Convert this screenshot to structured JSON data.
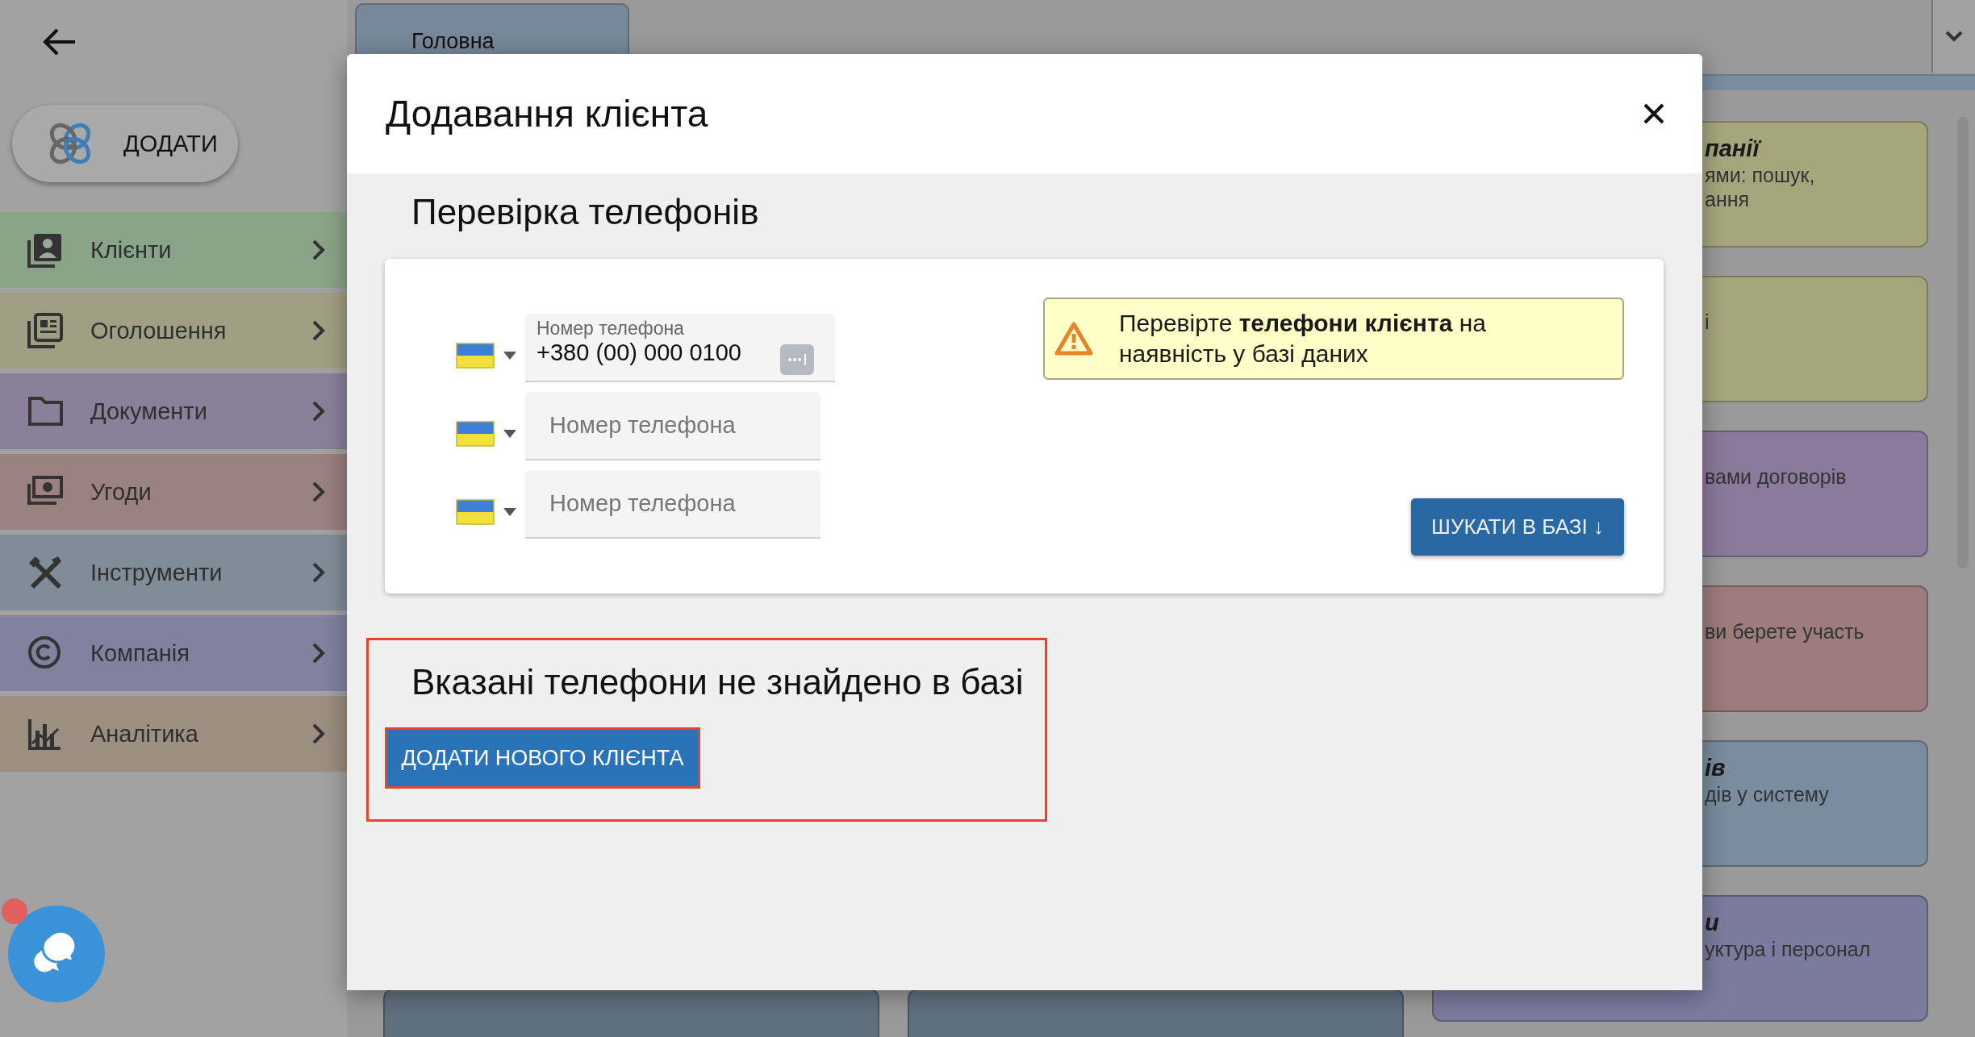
{
  "sidebar": {
    "add_button": {
      "label": "ДОДАТИ"
    },
    "items": [
      {
        "label": "Клієнти",
        "color": "#89a488"
      },
      {
        "label": "Оголошення",
        "color": "#a09f83"
      },
      {
        "label": "Документи",
        "color": "#8a809a"
      },
      {
        "label": "Угоди",
        "color": "#9b8180"
      },
      {
        "label": "Інструменти",
        "color": "#808d99"
      },
      {
        "label": "Компанія",
        "color": "#8182a0"
      },
      {
        "label": "Аналітика",
        "color": "#9c8e80"
      }
    ]
  },
  "tab": {
    "label": "Головна"
  },
  "cards": [
    {
      "color": "#a6a67e",
      "title": "панії",
      "lines": [
        "ями: пошук,",
        "ання"
      ]
    },
    {
      "color": "#a6a67e",
      "lines": [
        "і"
      ]
    },
    {
      "color": "#8a7a9c",
      "lines": [
        "вами договорів"
      ]
    },
    {
      "color": "#9c7c7c",
      "lines": [
        "ви берете участь"
      ]
    },
    {
      "color": "#7a8ca0",
      "title": "ів",
      "lines": [
        "дів у систему"
      ]
    },
    {
      "color": "#7b7b9e",
      "title": "и",
      "lines": [
        "уктура і персонал"
      ]
    }
  ],
  "bottom_cards": [
    {
      "color": "#61707f"
    },
    {
      "color": "#61707f"
    }
  ],
  "modal": {
    "title": "Додавання клієнта",
    "section_title": "Перевірка телефонів",
    "phones": [
      {
        "placeholder": "Номер телефона",
        "value": "+380 (00) 000 0100"
      },
      {
        "placeholder": "Номер телефона"
      },
      {
        "placeholder": "Номер телефона"
      }
    ],
    "notice": "Перевірте **телефони клієнта** на наявність у базі даних",
    "search_button": "ШУКАТИ В БАЗІ ↓",
    "result": {
      "message": "Вказані телефони не знайдено в базі",
      "button": "ДОДАТИ НОВОГО КЛІЄНТА",
      "highlighted": true
    }
  }
}
